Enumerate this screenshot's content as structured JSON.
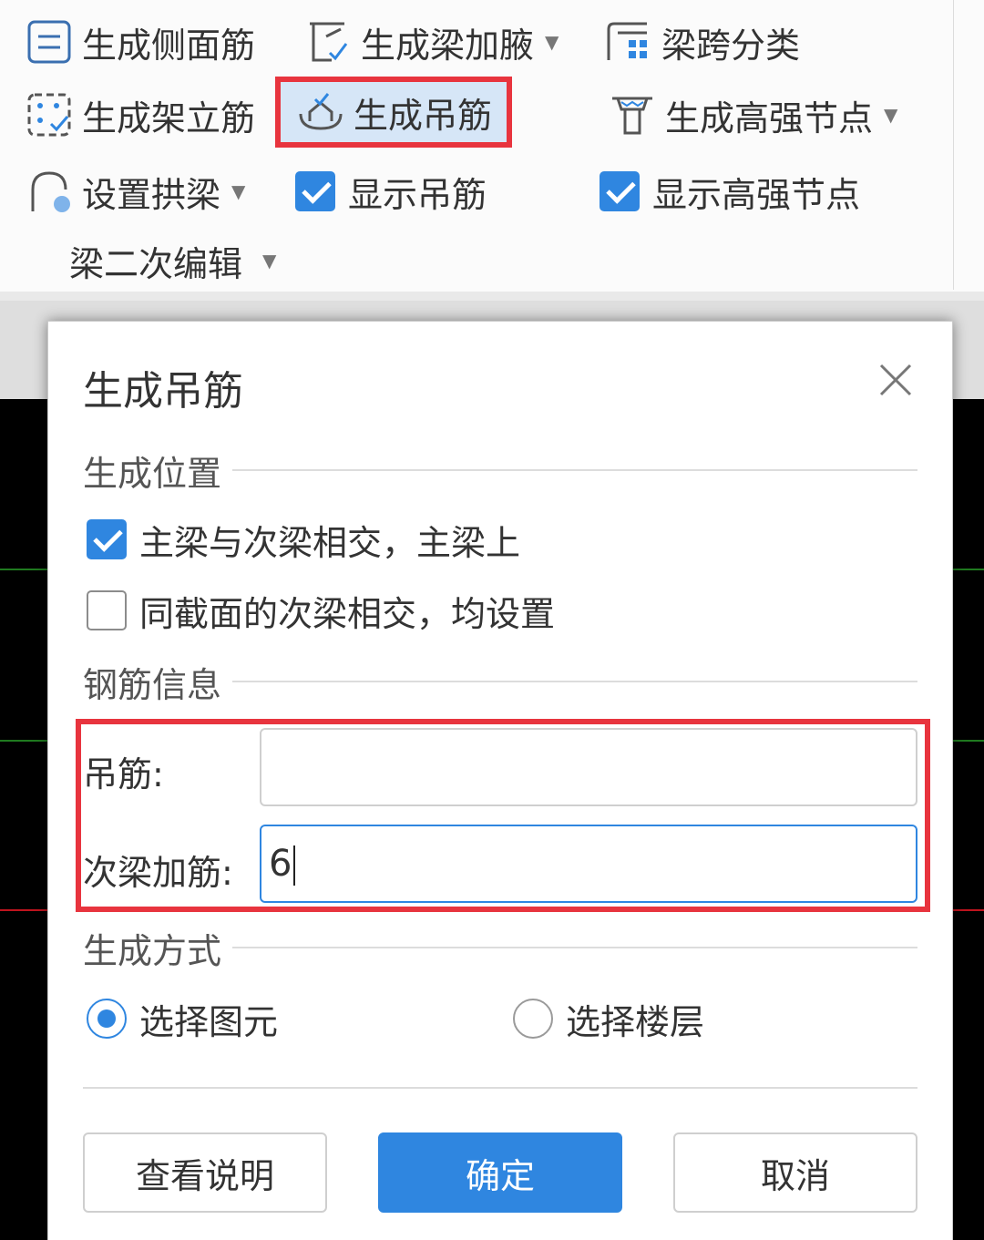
{
  "ribbon": {
    "row1": {
      "gen_side_rebar": "生成侧面筋",
      "gen_haunch": "生成梁加腋",
      "span_classify": "梁跨分类"
    },
    "row2": {
      "gen_erection_bar": "生成架立筋",
      "gen_hanger_bar": "生成吊筋",
      "gen_high_strength_joint": "生成高强节点"
    },
    "row3": {
      "set_arch_beam": "设置拱梁",
      "show_hanger_bar": "显示吊筋",
      "show_high_strength_joint": "显示高强节点"
    },
    "row4": {
      "beam_secondary_edit": "梁二次编辑"
    }
  },
  "dialog": {
    "title": "生成吊筋",
    "position_section": "生成位置",
    "option_main_beam": "主梁与次梁相交，主梁上",
    "option_same_section": "同截面的次梁相交，均设置",
    "rebar_section": "钢筋信息",
    "hanger_label": "吊筋:",
    "hanger_value": "",
    "secondary_label": "次梁加筋:",
    "secondary_value": "6",
    "method_section": "生成方式",
    "radio_select_element": "选择图元",
    "radio_select_floor": "选择楼层",
    "btn_help": "查看说明",
    "btn_ok": "确定",
    "btn_cancel": "取消"
  },
  "colors": {
    "accent": "#2f86e0",
    "highlight_border": "#e8343e",
    "canvas_green": "#1f7a1f",
    "canvas_red": "#c0141e"
  }
}
